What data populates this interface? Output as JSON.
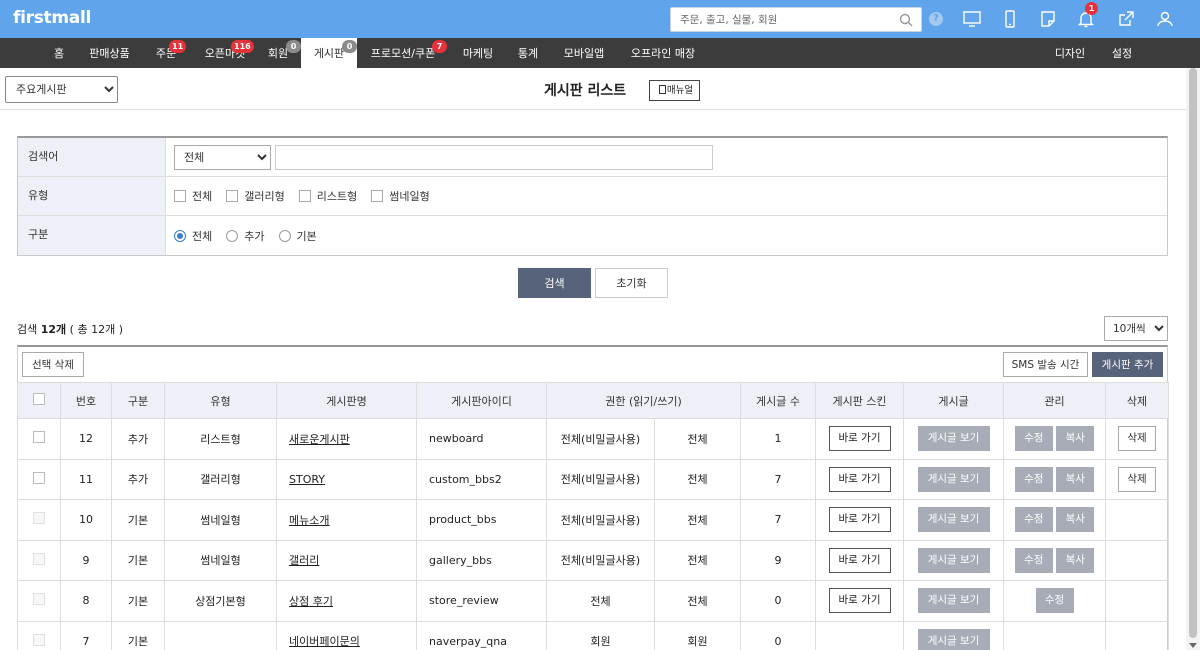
{
  "header": {
    "logo": "firstmall",
    "search_placeholder": "주문, 출고, 실물, 회원",
    "help": "?",
    "alert_badge": "1"
  },
  "nav": {
    "items": [
      {
        "label": "홈"
      },
      {
        "label": "판매상품"
      },
      {
        "label": "주문",
        "badge": "11"
      },
      {
        "label": "오픈마켓",
        "badge": "116"
      },
      {
        "label": "회원",
        "badge": "0"
      },
      {
        "label": "게시판",
        "badge": "0"
      },
      {
        "label": "프로모션/쿠폰",
        "badge": "7"
      },
      {
        "label": "마케팅"
      },
      {
        "label": "통계"
      },
      {
        "label": "모바일앱"
      },
      {
        "label": "오프라인 매장"
      }
    ],
    "right": [
      {
        "label": "디자인"
      },
      {
        "label": "설정"
      }
    ]
  },
  "title_row": {
    "board_select": "주요게시판",
    "title": "게시판 리스트",
    "manual": "매뉴얼"
  },
  "search": {
    "rows": {
      "keyword": {
        "label": "검색어",
        "select": "전체"
      },
      "type": {
        "label": "유형",
        "options": [
          "전체",
          "갤러리형",
          "리스트형",
          "썸네일형"
        ]
      },
      "category": {
        "label": "구분",
        "options": [
          "전체",
          "추가",
          "기본"
        ],
        "selected": "전체"
      }
    },
    "search_btn": "검색",
    "reset_btn": "초기화"
  },
  "result": {
    "count_label": "검색 ",
    "count_value": "12개",
    "total": " ( 총 12개 )",
    "per_page": "10개씩"
  },
  "toolbar": {
    "delete_selected": "선택 삭제",
    "sms_time": "SMS 발송 시간",
    "add_board": "게시판 추가"
  },
  "table": {
    "headers": [
      "번호",
      "구분",
      "유형",
      "게시판명",
      "게시판아이디",
      "권한 (읽기/쓰기)",
      "게시글 수",
      "게시판 스킨",
      "게시글",
      "관리",
      "삭제"
    ],
    "go_label": "바로 가기",
    "view_label": "게시글 보기",
    "edit_label": "수정",
    "copy_label": "복사",
    "delete_label": "삭제",
    "rows": [
      {
        "no": "12",
        "kind": "추가",
        "type": "리스트형",
        "name": "새로운게시판",
        "id": "newboard",
        "read": "전체(비밀글사용)",
        "write": "전체",
        "count": "1",
        "skin": true,
        "edit": true,
        "copy": true,
        "del": true,
        "chk": true
      },
      {
        "no": "11",
        "kind": "추가",
        "type": "갤러리형",
        "name": "STORY",
        "id": "custom_bbs2",
        "read": "전체(비밀글사용)",
        "write": "전체",
        "count": "7",
        "skin": true,
        "edit": true,
        "copy": true,
        "del": true,
        "chk": true
      },
      {
        "no": "10",
        "kind": "기본",
        "type": "썸네일형",
        "name": "메뉴소개",
        "id": "product_bbs",
        "read": "전체(비밀글사용)",
        "write": "전체",
        "count": "7",
        "skin": true,
        "edit": true,
        "copy": true,
        "del": false,
        "chk": false
      },
      {
        "no": "9",
        "kind": "기본",
        "type": "썸네일형",
        "name": "갤러리",
        "id": "gallery_bbs",
        "read": "전체(비밀글사용)",
        "write": "전체",
        "count": "9",
        "skin": true,
        "edit": true,
        "copy": true,
        "del": false,
        "chk": false
      },
      {
        "no": "8",
        "kind": "기본",
        "type": "상점기본형",
        "name": "상점 후기",
        "id": "store_review",
        "read": "전체",
        "write": "전체",
        "count": "0",
        "skin": true,
        "edit": true,
        "copy": false,
        "del": false,
        "chk": false
      },
      {
        "no": "7",
        "kind": "기본",
        "type": "",
        "name": "네이버페이문의",
        "id": "naverpay_qna",
        "read": "회원",
        "write": "회원",
        "count": "0",
        "skin": false,
        "edit": false,
        "copy": false,
        "del": false,
        "chk": false
      }
    ]
  },
  "colors": {
    "header_bg": "#60a4ec",
    "nav_bg": "#3c3c3c",
    "badge": "#e8323a",
    "primary_btn": "#57637b",
    "gray_btn": "#a7acb6"
  }
}
